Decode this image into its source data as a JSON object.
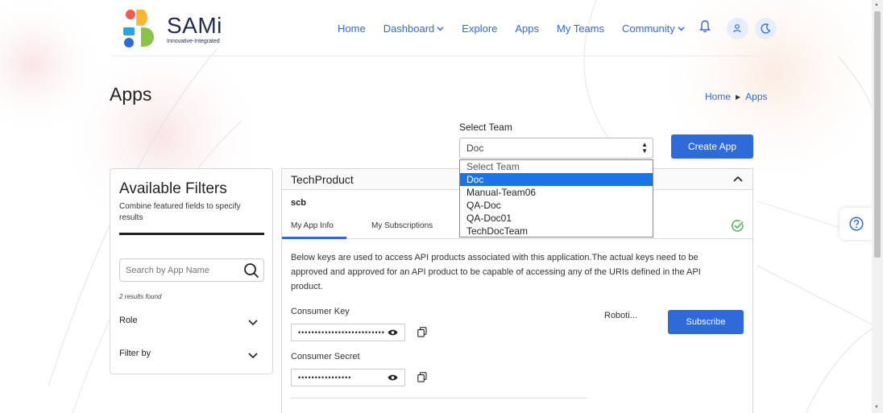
{
  "brand": {
    "name": "SAMi",
    "tagline": "Innovative-Integrated"
  },
  "nav": {
    "items": [
      "Home",
      "Dashboard",
      "Explore",
      "Apps",
      "My Teams",
      "Community"
    ]
  },
  "page": {
    "title": "Apps"
  },
  "breadcrumb": {
    "home": "Home",
    "current": "Apps"
  },
  "team": {
    "label": "Select Team",
    "selected": "Doc",
    "options": [
      "Select Team",
      "Doc",
      "Manual-Team06",
      "QA-Doc",
      "QA-Doc01",
      "TechDocTeam"
    ]
  },
  "create_app_label": "Create App",
  "filters": {
    "title": "Available Filters",
    "description": "Combine featured fields to specify results",
    "search_placeholder": "Search by App Name",
    "results_text": "2 results found",
    "role_label": "Role",
    "filter_by_label": "Filter by"
  },
  "app": {
    "product": "TechProduct",
    "name": "scb",
    "tabs": [
      "My App Info",
      "My Subscriptions"
    ],
    "description": "Below keys are used to access API products associated with this application.The actual keys need to be approved and approved for an API product to be capable of accessing any of the URIs defined in the API product.",
    "consumer_key_label": "Consumer Key",
    "consumer_key_masked": "••••••••••••••••••••••••••",
    "consumer_secret_label": "Consumer Secret",
    "consumer_secret_masked": "••••••••••••••••",
    "product_name_truncated": "Roboti...",
    "subscribe_label": "Subscribe"
  },
  "colors": {
    "accent": "#2f6bd8",
    "selected_option": "#1a73e8",
    "success": "#4caf50"
  }
}
